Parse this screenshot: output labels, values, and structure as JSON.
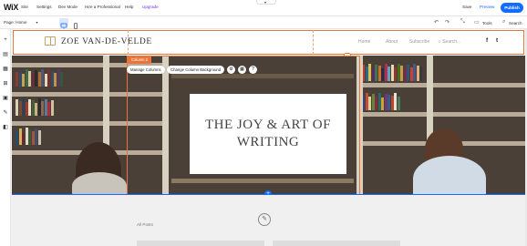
{
  "editor": {
    "logo": "WiX",
    "menu": [
      "Site",
      "Settings",
      "Dev Mode",
      "Hire a Professional",
      "Help",
      "Upgrade"
    ],
    "save": "Save",
    "preview": "Preview",
    "publish": "Publish",
    "page_label": "Page: Home",
    "tools_label": "Tools",
    "search_label": "Search",
    "accent_color": "#116dff",
    "selection_color": "#e8763b"
  },
  "site": {
    "name": "ZOE VAN-DE-VELDE",
    "nav": [
      "Home",
      "About",
      "Subscribe"
    ],
    "search_placeholder": "Search...",
    "social": [
      "f",
      "t"
    ]
  },
  "hero": {
    "column_badge": "Column 2",
    "manage_columns": "Manage Columns",
    "change_background": "Change Column Background",
    "title": "THE JOY & ART OF WRITING"
  },
  "posts": {
    "label": "All Posts"
  }
}
